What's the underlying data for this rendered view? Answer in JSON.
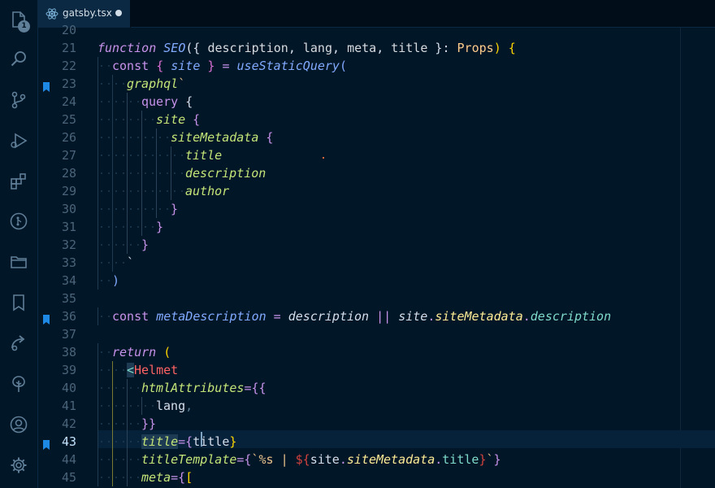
{
  "activity_bar": {
    "items": [
      {
        "name": "explorer-icon",
        "badge": "1"
      },
      {
        "name": "search-icon"
      },
      {
        "name": "source-control-icon"
      },
      {
        "name": "run-debug-icon"
      },
      {
        "name": "extensions-icon"
      },
      {
        "name": "gitlens-icon"
      },
      {
        "name": "folders-icon"
      },
      {
        "name": "bookmarks-icon"
      },
      {
        "name": "remote-icon"
      },
      {
        "name": "tree-icon"
      },
      {
        "name": "account-icon"
      },
      {
        "name": "settings-gear-icon"
      }
    ]
  },
  "tab": {
    "label": "gatsby.tsx",
    "icon": "react-icon",
    "modified": true
  },
  "editor": {
    "cursor_line": "43",
    "bookmarked_lines": [
      "23",
      "36",
      "43"
    ],
    "lines": [
      {
        "n": "20",
        "indent": 0,
        "t": [
          {
            "v": "",
            "c": "#d6deeb"
          }
        ]
      },
      {
        "n": "21",
        "indent": 0,
        "t": [
          {
            "v": "function ",
            "c": "#c792ea",
            "i": true
          },
          {
            "v": "SEO",
            "c": "#82aaff",
            "i": true
          },
          {
            "v": "({ ",
            "c": "#d6deeb"
          },
          {
            "v": "description",
            "c": "#d7dbe0"
          },
          {
            "v": ", ",
            "c": "#d6deeb"
          },
          {
            "v": "lang",
            "c": "#d7dbe0"
          },
          {
            "v": ", ",
            "c": "#d6deeb"
          },
          {
            "v": "meta",
            "c": "#d7dbe0"
          },
          {
            "v": ", ",
            "c": "#d6deeb"
          },
          {
            "v": "title",
            "c": "#d7dbe0"
          },
          {
            "v": " }: ",
            "c": "#d6deeb"
          },
          {
            "v": "Props",
            "c": "#ffcb8b"
          },
          {
            "v": ") {",
            "c": "#ffd700"
          }
        ]
      },
      {
        "n": "22",
        "indent": 1,
        "t": [
          {
            "v": "const ",
            "c": "#c792ea"
          },
          {
            "v": "{ ",
            "c": "#da70d6"
          },
          {
            "v": "site",
            "c": "#82aaff",
            "i": true
          },
          {
            "v": " } ",
            "c": "#da70d6"
          },
          {
            "v": "= ",
            "c": "#c792ea"
          },
          {
            "v": "useStaticQuery",
            "c": "#82aaff",
            "i": true
          },
          {
            "v": "(",
            "c": "#82aaff"
          }
        ]
      },
      {
        "n": "23",
        "indent": 2,
        "t": [
          {
            "v": "graphql",
            "c": "#c5e478",
            "i": true
          },
          {
            "v": "`",
            "c": "#ecc48d"
          }
        ]
      },
      {
        "n": "24",
        "indent": 3,
        "t": [
          {
            "v": "query ",
            "c": "#c792ea"
          },
          {
            "v": "{",
            "c": "#d6deeb"
          }
        ]
      },
      {
        "n": "25",
        "indent": 4,
        "t": [
          {
            "v": "site",
            "c": "#c5e478",
            "i": true
          },
          {
            "v": " {",
            "c": "#c792ea"
          }
        ]
      },
      {
        "n": "26",
        "indent": 5,
        "t": [
          {
            "v": "siteMetadata",
            "c": "#c5e478",
            "i": true
          },
          {
            "v": " {",
            "c": "#c792ea"
          }
        ]
      },
      {
        "n": "27",
        "indent": 6,
        "t": [
          {
            "v": "title",
            "c": "#c5e478",
            "i": true
          }
        ]
      },
      {
        "n": "28",
        "indent": 6,
        "t": [
          {
            "v": "description",
            "c": "#c5e478",
            "i": true
          }
        ]
      },
      {
        "n": "29",
        "indent": 6,
        "t": [
          {
            "v": "author",
            "c": "#c5e478",
            "i": true
          }
        ]
      },
      {
        "n": "30",
        "indent": 5,
        "t": [
          {
            "v": "}",
            "c": "#c792ea"
          }
        ]
      },
      {
        "n": "31",
        "indent": 4,
        "t": [
          {
            "v": "}",
            "c": "#c792ea"
          }
        ]
      },
      {
        "n": "32",
        "indent": 3,
        "t": [
          {
            "v": "}",
            "c": "#c792ea"
          }
        ]
      },
      {
        "n": "33",
        "indent": 2,
        "t": [
          {
            "v": "`",
            "c": "#d6deeb"
          }
        ]
      },
      {
        "n": "34",
        "indent": 1,
        "t": [
          {
            "v": ")",
            "c": "#82aaff"
          }
        ]
      },
      {
        "n": "35",
        "indent": 0,
        "t": [
          {
            "v": "",
            "c": "#d6deeb"
          }
        ]
      },
      {
        "n": "36",
        "indent": 1,
        "t": [
          {
            "v": "const ",
            "c": "#c792ea"
          },
          {
            "v": "metaDescription",
            "c": "#82aaff",
            "i": true
          },
          {
            "v": " = ",
            "c": "#c792ea"
          },
          {
            "v": "description",
            "c": "#d6deeb",
            "i": true
          },
          {
            "v": " || ",
            "c": "#c792ea"
          },
          {
            "v": "site",
            "c": "#d6deeb",
            "i": true
          },
          {
            "v": ".",
            "c": "#c792ea"
          },
          {
            "v": "siteMetadata",
            "c": "#ffeb95",
            "i": true
          },
          {
            "v": ".",
            "c": "#c792ea"
          },
          {
            "v": "description",
            "c": "#7fdbca",
            "i": true
          }
        ]
      },
      {
        "n": "37",
        "indent": 0,
        "t": [
          {
            "v": "",
            "c": "#d6deeb"
          }
        ]
      },
      {
        "n": "38",
        "indent": 1,
        "t": [
          {
            "v": "return",
            "c": "#c792ea",
            "i": true
          },
          {
            "v": " (",
            "c": "#ffd700"
          }
        ]
      },
      {
        "n": "39",
        "indent": 2,
        "t": [
          {
            "v": "<",
            "c": "#7fdbca",
            "sel": true
          },
          {
            "v": "Helmet",
            "c": "#ff6363"
          }
        ]
      },
      {
        "n": "40",
        "indent": 3,
        "t": [
          {
            "v": "htmlAttributes",
            "c": "#c5e478",
            "i": true
          },
          {
            "v": "={{",
            "c": "#c792ea"
          }
        ]
      },
      {
        "n": "41",
        "indent": 4,
        "t": [
          {
            "v": "lang",
            "c": "#d6deeb"
          },
          {
            "v": ",",
            "c": "#5f7e97"
          }
        ]
      },
      {
        "n": "42",
        "indent": 3,
        "t": [
          {
            "v": "}}",
            "c": "#c792ea"
          }
        ]
      },
      {
        "n": "43",
        "indent": 3,
        "t": [
          {
            "v": "title",
            "c": "#c5e478",
            "i": true,
            "sel": true
          },
          {
            "v": "={",
            "c": "#c792ea"
          },
          {
            "v": "title",
            "c": "#d6deeb"
          },
          {
            "v": "}",
            "c": "#ffd700"
          }
        ]
      },
      {
        "n": "44",
        "indent": 3,
        "t": [
          {
            "v": "titleTemplate",
            "c": "#c5e478",
            "i": true
          },
          {
            "v": "={",
            "c": "#c792ea"
          },
          {
            "v": "`%s | ",
            "c": "#ecc48d"
          },
          {
            "v": "${",
            "c": "#d3423e"
          },
          {
            "v": "site",
            "c": "#d6deeb"
          },
          {
            "v": ".",
            "c": "#c792ea"
          },
          {
            "v": "siteMetadata",
            "c": "#ffeb95",
            "i": true
          },
          {
            "v": ".",
            "c": "#c792ea"
          },
          {
            "v": "title",
            "c": "#7fdbca"
          },
          {
            "v": "}",
            "c": "#d3423e"
          },
          {
            "v": "`",
            "c": "#ecc48d"
          },
          {
            "v": "}",
            "c": "#c792ea"
          }
        ]
      },
      {
        "n": "45",
        "indent": 3,
        "t": [
          {
            "v": "meta",
            "c": "#c5e478",
            "i": true
          },
          {
            "v": "={",
            "c": "#c792ea"
          },
          {
            "v": "[",
            "c": "#ffd700"
          }
        ]
      }
    ]
  }
}
